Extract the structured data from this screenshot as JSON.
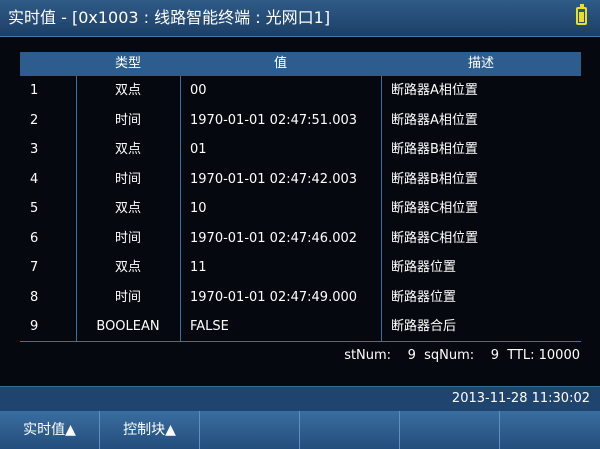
{
  "titlebar": {
    "title": "实时值 - [0x1003 : 线路智能终端 : 光网口1]"
  },
  "table": {
    "columns": [
      "",
      "类型",
      "值",
      "描述"
    ],
    "rows": [
      {
        "index": "1",
        "type": "双点",
        "value": "00",
        "desc": "断路器A相位置"
      },
      {
        "index": "2",
        "type": "时间",
        "value": "1970-01-01 02:47:51.003",
        "desc": "断路器A相位置"
      },
      {
        "index": "3",
        "type": "双点",
        "value": "01",
        "desc": "断路器B相位置"
      },
      {
        "index": "4",
        "type": "时间",
        "value": "1970-01-01 02:47:42.003",
        "desc": "断路器B相位置"
      },
      {
        "index": "5",
        "type": "双点",
        "value": "10",
        "desc": "断路器C相位置"
      },
      {
        "index": "6",
        "type": "时间",
        "value": "1970-01-01 02:47:46.002",
        "desc": "断路器C相位置"
      },
      {
        "index": "7",
        "type": "双点",
        "value": "11",
        "desc": "断路器位置"
      },
      {
        "index": "8",
        "type": "时间",
        "value": "1970-01-01 02:47:49.000",
        "desc": "断路器位置"
      },
      {
        "index": "9",
        "type": "BOOLEAN",
        "value": "FALSE",
        "desc": "断路器合后"
      }
    ]
  },
  "status": {
    "text": "stNum:    9  sqNum:    9  TTL: 10000"
  },
  "datetime": "2013-11-28 11:30:02",
  "footer": {
    "keys": [
      "实时值▲",
      "控制块▲",
      "",
      "",
      "",
      ""
    ]
  },
  "colors": {
    "header_bg": "#2d5d8e",
    "battery": "#e8e020"
  }
}
